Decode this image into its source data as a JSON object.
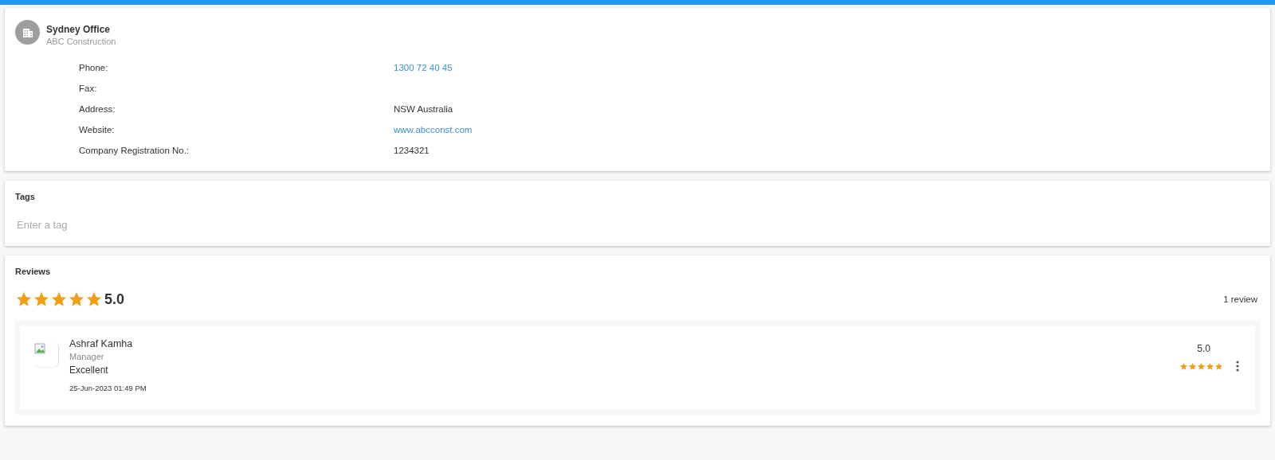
{
  "office": {
    "title": "Sydney Office",
    "subtitle": "ABC Construction",
    "details": [
      {
        "label": "Phone:",
        "value": "1300 72 40 45",
        "kind": "link"
      },
      {
        "label": "Fax:",
        "kind": "text"
      },
      {
        "label": "Address:",
        "value": "NSW Australia",
        "kind": "text"
      },
      {
        "label": "Website:",
        "value": "www.abcconst.com",
        "kind": "link"
      },
      {
        "label": "Company Registration No.:",
        "value": "1234321",
        "kind": "text"
      }
    ]
  },
  "tags": {
    "title": "Tags",
    "placeholder": "Enter a tag"
  },
  "reviews": {
    "title": "Reviews",
    "stars": 5,
    "average": "5.0",
    "count": "1 review",
    "items": [
      {
        "name": "Ashraf Kamha",
        "role": "Manager",
        "comment": "Excellent",
        "date": "25-Jun-2023 01:49 PM",
        "score": "5.0",
        "stars": 5
      }
    ]
  }
}
